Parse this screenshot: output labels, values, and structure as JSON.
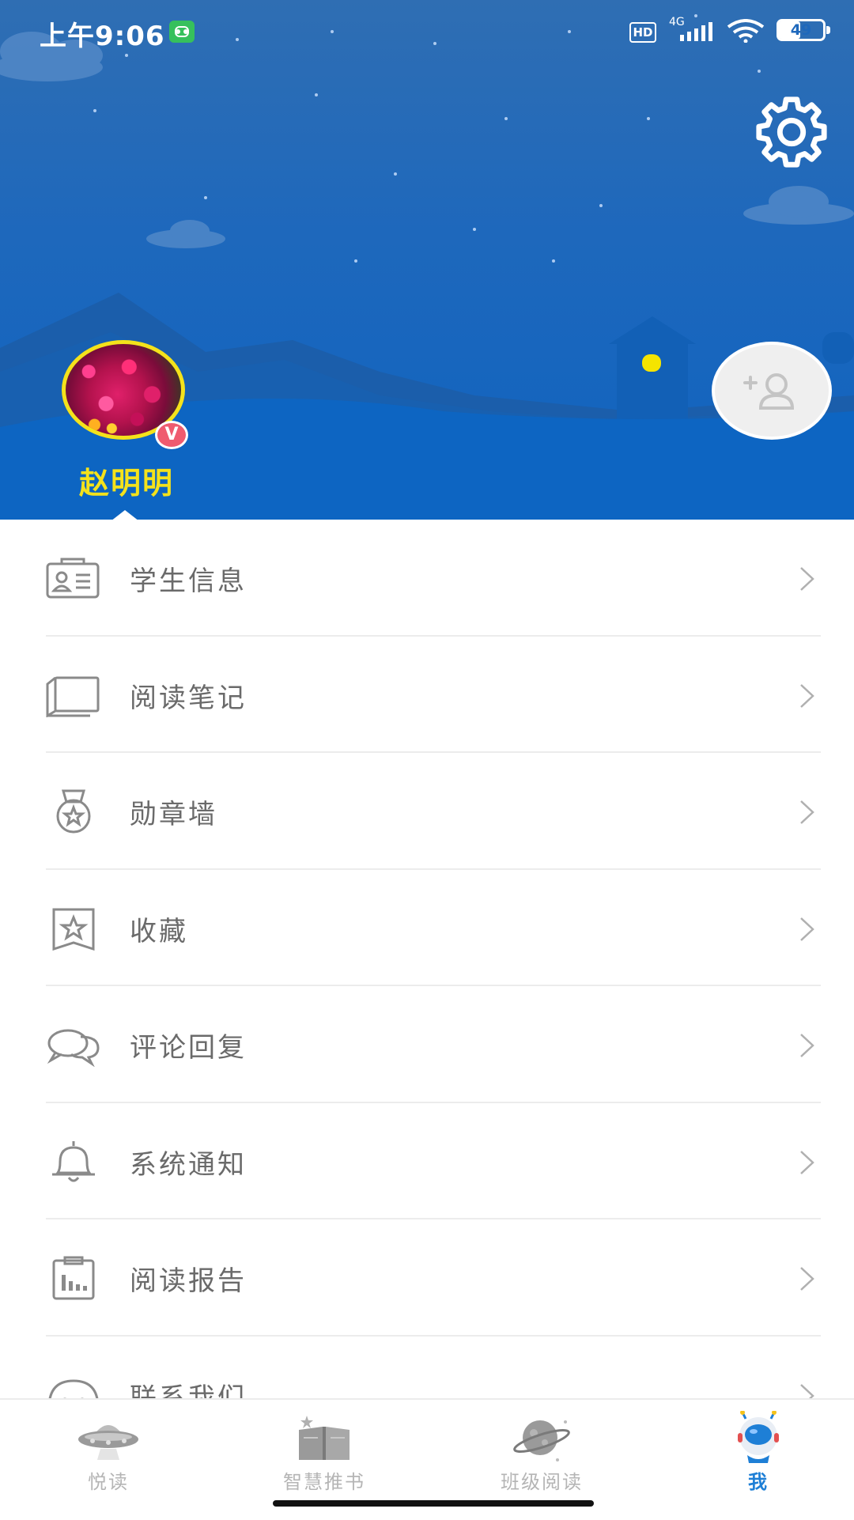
{
  "status_bar": {
    "time": "上午9:06",
    "hd_label": "HD",
    "network_type": "4G",
    "battery_level": "49",
    "battery_fraction": 0.49
  },
  "profile": {
    "name": "赵明明",
    "vip_badge": "V"
  },
  "menu": [
    {
      "label": "学生信息",
      "icon": "id-card-icon"
    },
    {
      "label": "阅读笔记",
      "icon": "notebook-icon"
    },
    {
      "label": "勋章墙",
      "icon": "medal-icon"
    },
    {
      "label": "收藏",
      "icon": "star-bookmark-icon"
    },
    {
      "label": "评论回复",
      "icon": "chat-bubbles-icon"
    },
    {
      "label": "系统通知",
      "icon": "bell-icon"
    },
    {
      "label": "阅读报告",
      "icon": "report-chart-icon"
    },
    {
      "label": "联系我们",
      "icon": "headset-icon"
    }
  ],
  "bottom_nav": [
    {
      "label": "悦读",
      "icon": "ufo-icon",
      "active": false
    },
    {
      "label": "智慧推书",
      "icon": "open-book-icon",
      "active": false
    },
    {
      "label": "班级阅读",
      "icon": "planet-icon",
      "active": false
    },
    {
      "label": "我",
      "icon": "astronaut-icon",
      "active": true
    }
  ],
  "colors": {
    "header_blue": "#1e68bc",
    "name_yellow": "#f4e21b",
    "active_tab": "#1e7fd6",
    "text_gray": "#6a6a6a"
  }
}
